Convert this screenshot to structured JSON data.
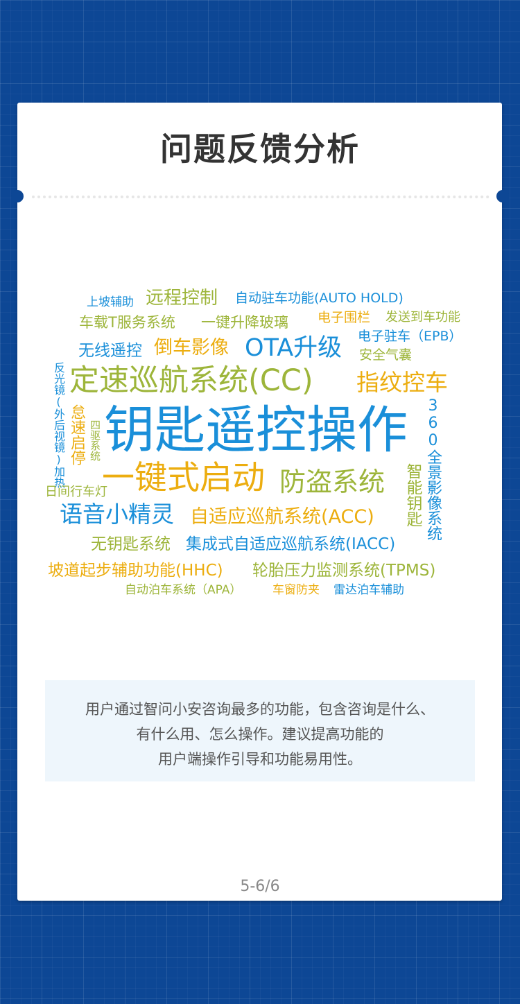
{
  "title": "问题反馈分析",
  "colors": {
    "blue": "#1a8fd9",
    "olive": "#9db53a",
    "gold": "#ecad0f",
    "background": "#0d4795"
  },
  "word_cloud": [
    "上坡辅助",
    "远程控制",
    "自动驻车功能(AUTO HOLD)",
    "车载T服务系统",
    "一键升降玻璃",
    "电子围栏",
    "发送到车功能",
    "无线遥控",
    "倒车影像",
    "OTA升级",
    "电子驻车（EPB）",
    "安全气囊",
    "定速巡航系统(CC)",
    "指纹控车",
    "反光镜(外后视镜)加热",
    "怠速启停",
    "四驱系统",
    "钥匙遥控操作",
    "360全景影像系统",
    "一键式启动",
    "防盗系统",
    "智能钥匙",
    "日间行车灯",
    "语音小精灵",
    "自适应巡航系统(ACC)",
    "无钥匙系统",
    "集成式自适应巡航系统(IACC)",
    "坡道起步辅助功能(HHC)",
    "轮胎压力监测系统(TPMS)",
    "自动泊车系统（APA）",
    "车窗防夹",
    "雷达泊车辅助"
  ],
  "note": [
    "用户通过智问小安咨询最多的功能，包含咨询是什么、",
    "有什么用、怎么操作。建议提高功能的",
    "用户端操作引导和功能易用性。"
  ],
  "pager": "5-6/6"
}
